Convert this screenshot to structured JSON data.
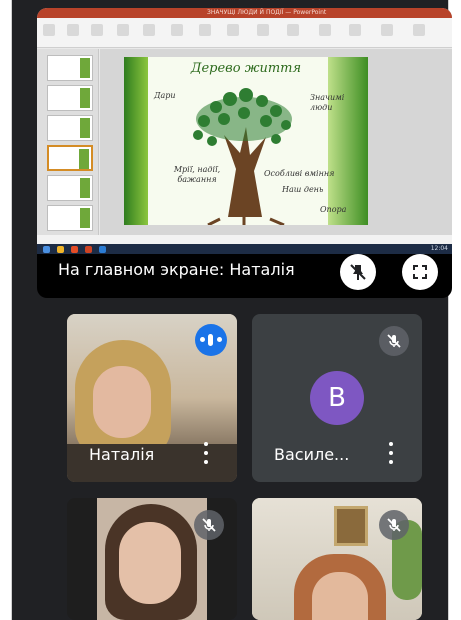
{
  "presentation": {
    "app_title": "ЗНАЧУЩІ ЛЮДИ Й ПОДІЇ — PowerPoint",
    "slide_title": "Дерево життя",
    "slide_words": [
      "Дари",
      "Значимі люди",
      "Мрії, надії, бажання",
      "Особливі вміння",
      "Наш день",
      "Опора"
    ],
    "clock": "12:04"
  },
  "present_label": "На главном экране: Наталія",
  "participants": [
    {
      "name": "Наталія",
      "mic": "speaking"
    },
    {
      "name": "Василе...",
      "mic": "muted",
      "avatar_letter": "В"
    },
    {
      "name": "",
      "mic": "muted"
    },
    {
      "name": "",
      "mic": "muted"
    }
  ],
  "colors": {
    "speaking": "#1a73e8",
    "avatar": "#7e57c2",
    "background": "#202124"
  }
}
